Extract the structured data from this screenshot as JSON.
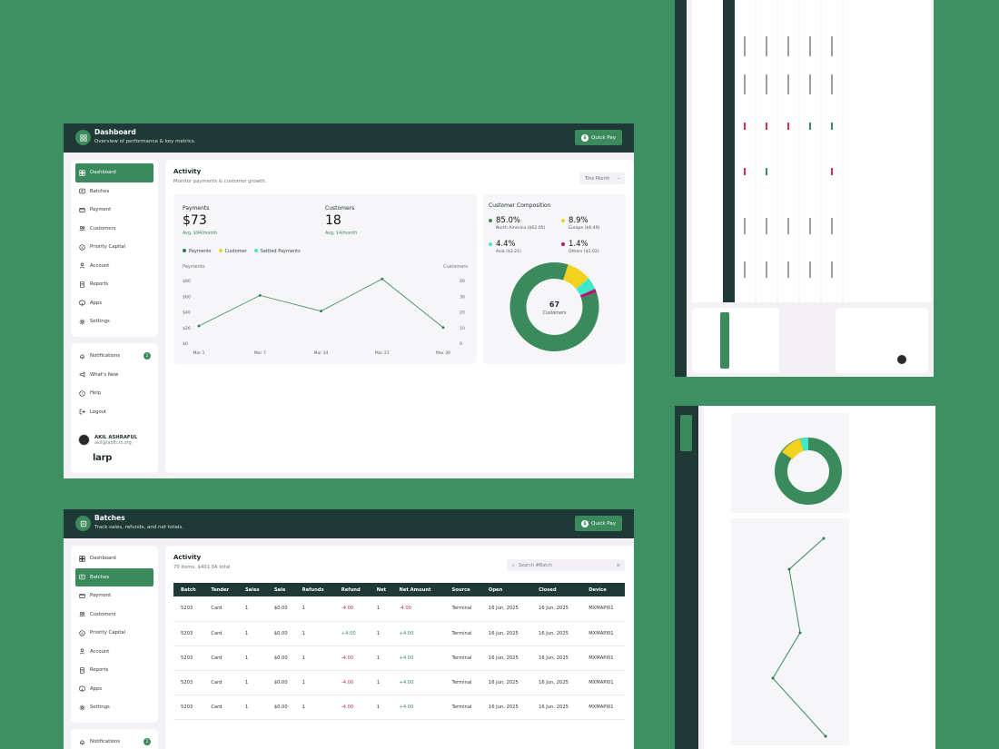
{
  "dashboard": {
    "title": "Dashboard",
    "subtitle": "Overview of performance & key metrics.",
    "quick_pay": "Quick Pay",
    "activity_title": "Activity",
    "activity_sub": "Monitor payments & customer growth.",
    "month_select": "This Month",
    "payments_label": "Payments",
    "payments_value": "$73",
    "payments_avg": "Avg. $94/month",
    "customers_label": "Customers",
    "customers_value": "18",
    "customers_avg": "Avg. 14/month",
    "legend": [
      "Payments",
      "Customer",
      "Settled Payments"
    ],
    "axis_left_title": "Payments",
    "axis_right_title": "Customers",
    "composition_title": "Customer Composition",
    "donut_center_value": "67",
    "donut_center_label": "Customers"
  },
  "composition": [
    {
      "pct": "85.0%",
      "region": "North America ($62.05)",
      "color": "#3b8a5c",
      "value": 85.0
    },
    {
      "pct": "8.9%",
      "region": "Europe ($6.49)",
      "color": "#f2d21e",
      "value": 8.9
    },
    {
      "pct": "4.4%",
      "region": "Asia ($3.21)",
      "color": "#3fe8c9",
      "value": 4.4
    },
    {
      "pct": "1.4%",
      "region": "Others ($1.02)",
      "color": "#b0186c",
      "value": 1.4
    }
  ],
  "chart_data": {
    "type": "line",
    "x": [
      "Mar 1",
      "Mar 7",
      "Mar 14",
      "Mar 21",
      "Mar 30"
    ],
    "series": [
      {
        "name": "Payments",
        "values": [
          22,
          61,
          41,
          82,
          20
        ]
      }
    ],
    "y_left_ticks": [
      "$80",
      "$60",
      "$40",
      "$26",
      "$0"
    ],
    "y_right_ticks": [
      "40",
      "30",
      "20",
      "10",
      "0"
    ],
    "ylim": [
      0,
      80
    ],
    "grid": false
  },
  "nav": {
    "items": [
      {
        "label": "Dashboard",
        "icon": "grid-icon"
      },
      {
        "label": "Batches",
        "icon": "batch-icon"
      },
      {
        "label": "Payment",
        "icon": "card-icon"
      },
      {
        "label": "Customers",
        "icon": "users-icon"
      },
      {
        "label": "Priority Capital",
        "icon": "dollar-icon"
      },
      {
        "label": "Account",
        "icon": "user-icon"
      },
      {
        "label": "Reports",
        "icon": "report-icon"
      },
      {
        "label": "Apps",
        "icon": "apps-icon"
      },
      {
        "label": "Settings",
        "icon": "gear-icon"
      }
    ],
    "bottom": [
      {
        "label": "Notifications",
        "icon": "bell-icon",
        "badge": "2"
      },
      {
        "label": "What's New",
        "icon": "megaphone-icon"
      },
      {
        "label": "Help",
        "icon": "help-icon"
      },
      {
        "label": "Logout",
        "icon": "logout-icon"
      }
    ],
    "user_name": "AKIL ASHRAFUL",
    "user_email": "akil@labftcro.org",
    "brand": "larp"
  },
  "batches": {
    "title": "Batches",
    "subtitle": "Track sales, refunds, and net totals.",
    "quick_pay": "Quick Pay",
    "activity_title": "Activity",
    "activity_sub": "70 items, $401.0A total",
    "search_placeholder": "Search #Batch",
    "columns": [
      "Batch",
      "Tender",
      "Sales",
      "Sale",
      "Refunds",
      "Refund",
      "Net",
      "Net Amount",
      "Source",
      "Open",
      "Closed",
      "Device"
    ],
    "rows": [
      [
        "5203",
        "Card",
        "1",
        "$0.00",
        "1",
        "-4.00",
        "1",
        "-4.00",
        "Terminal",
        "16 Jun, 2025",
        "16 Jun, 2025",
        "MXMAPI01"
      ],
      [
        "5203",
        "Card",
        "1",
        "$0.00",
        "1",
        "+4.00",
        "1",
        "+4.00",
        "Terminal",
        "16 Jun, 2025",
        "16 Jun, 2025",
        "MXMAPI01"
      ],
      [
        "5203",
        "Card",
        "1",
        "$0.00",
        "1",
        "-4.00",
        "1",
        "+4.00",
        "Terminal",
        "16 Jun, 2025",
        "16 Jun, 2025",
        "MXMAPI01"
      ],
      [
        "5203",
        "Card",
        "1",
        "$0.00",
        "1",
        "-4.00",
        "1",
        "+4.00",
        "Terminal",
        "16 Jun, 2025",
        "16 Jun, 2025",
        "MXMAPI01"
      ],
      [
        "5203",
        "Card",
        "1",
        "$0.00",
        "1",
        "-4.00",
        "1",
        "+4.00",
        "Terminal",
        "16 Jun, 2025",
        "16 Jun, 2025",
        "MXMAPI01"
      ]
    ]
  },
  "colors": {
    "background": "#3d9062",
    "topbar": "#1f3a36",
    "accent": "#3b8a5c",
    "negative": "#c7324a"
  }
}
